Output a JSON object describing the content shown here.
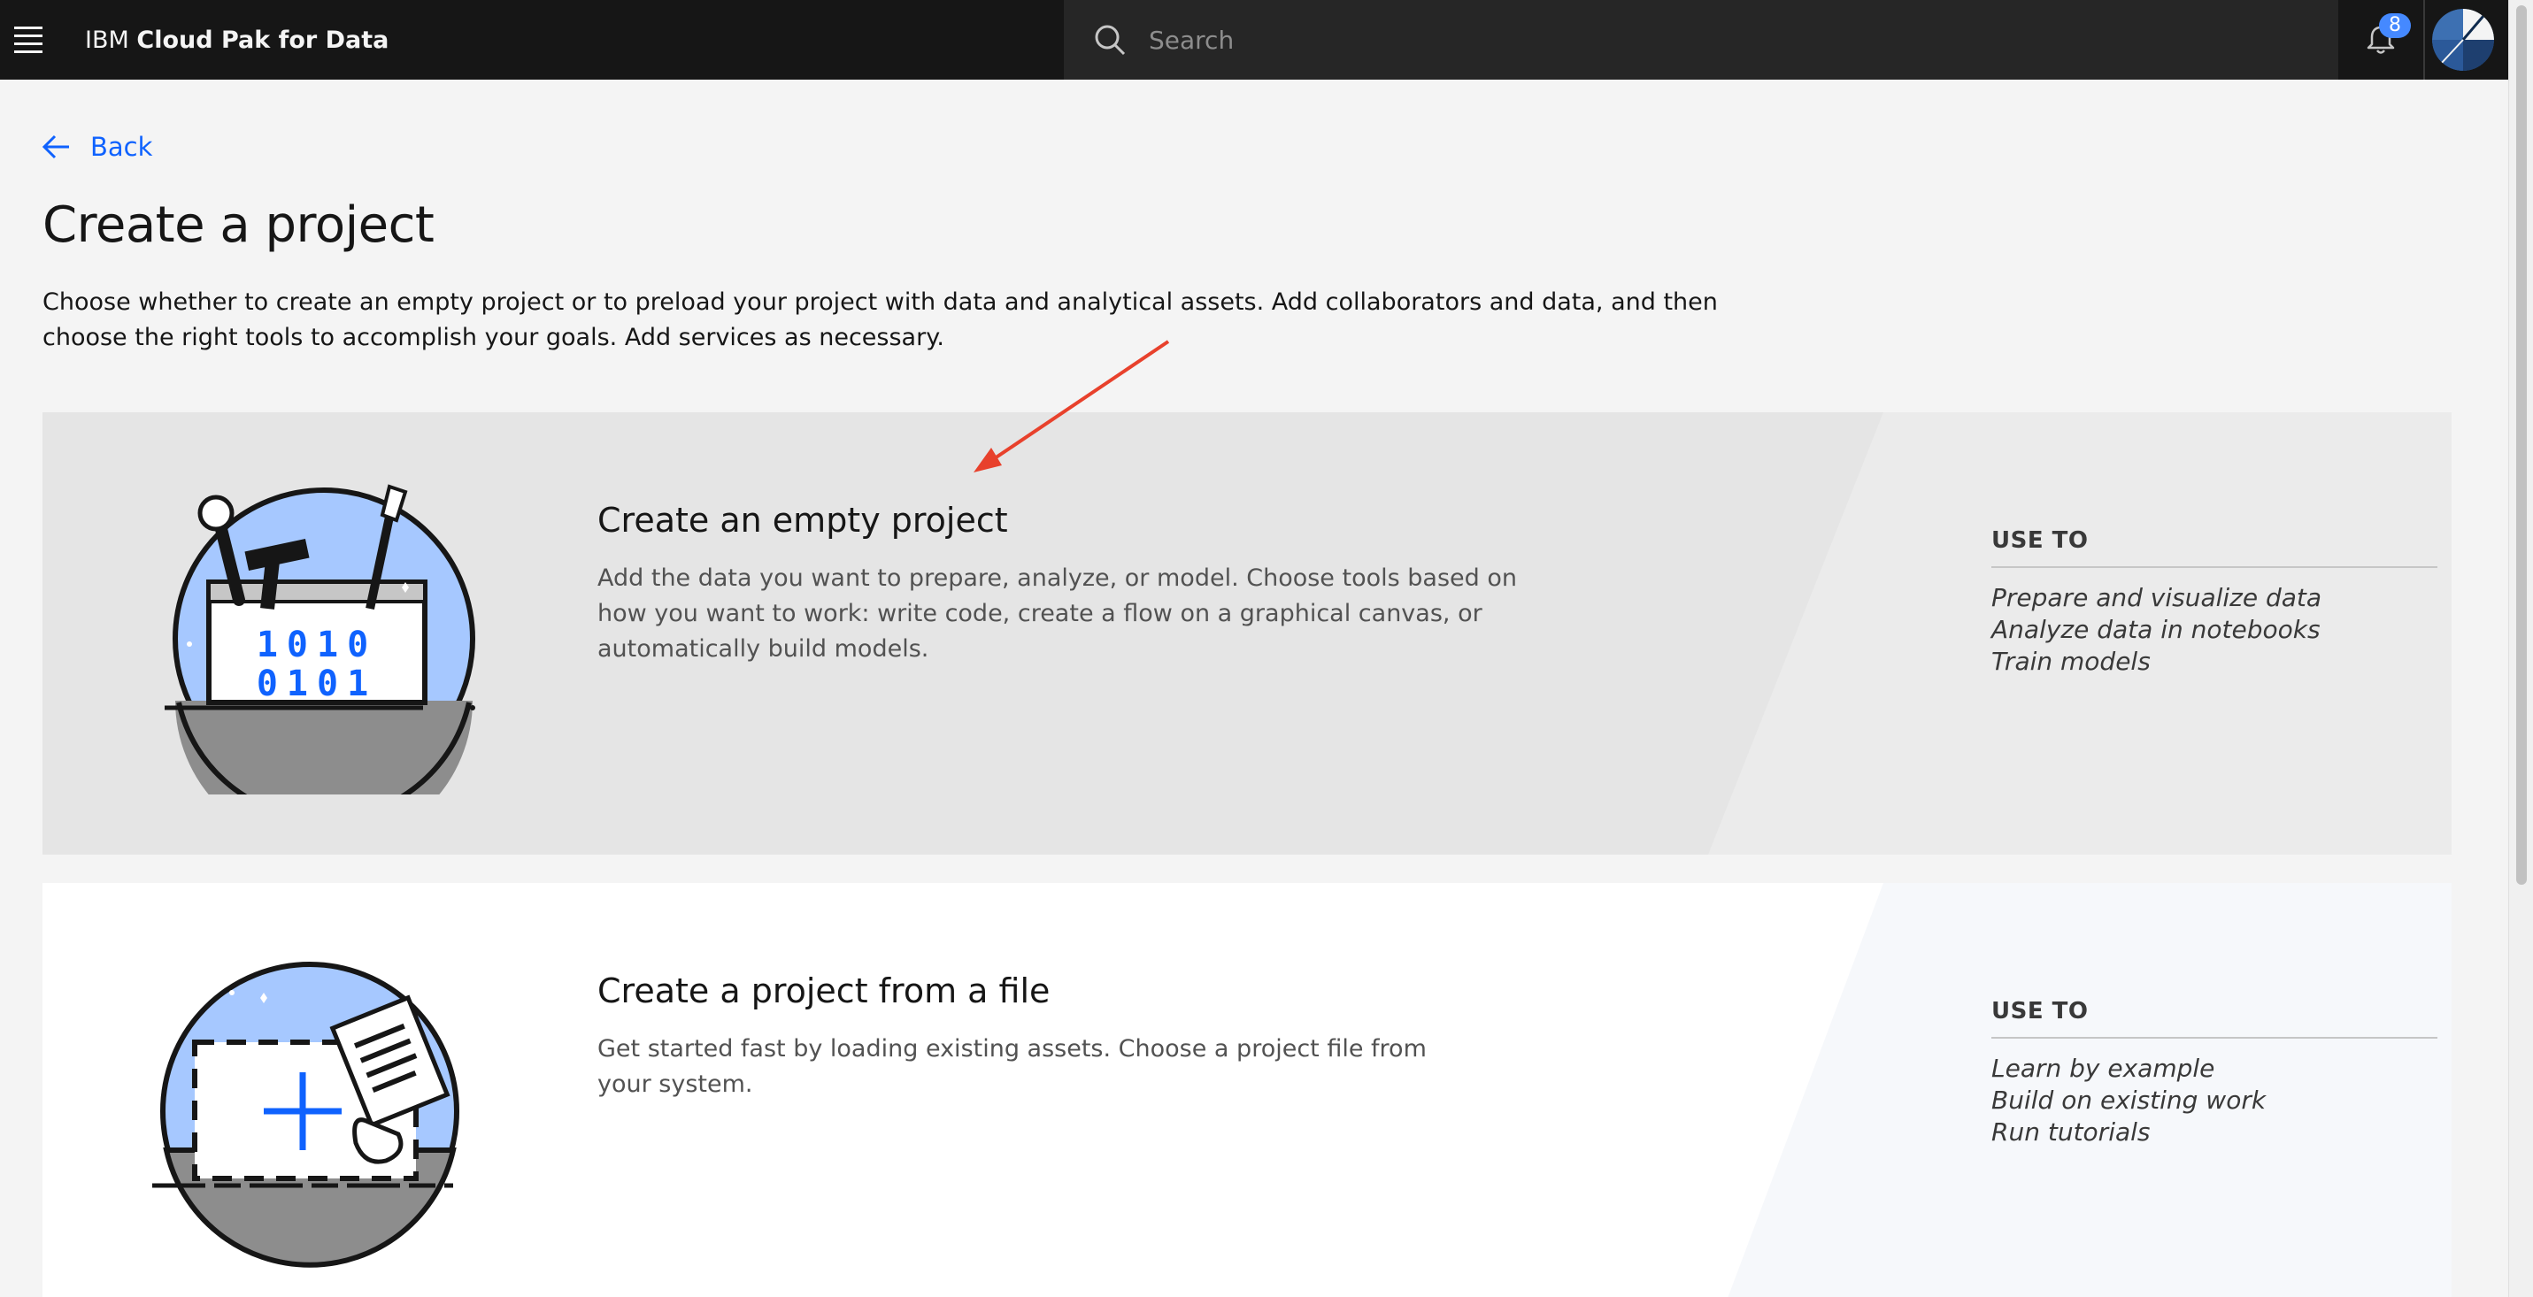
{
  "header": {
    "brand_prefix": "IBM",
    "brand_name": "Cloud Pak for Data",
    "search_placeholder": "Search",
    "notification_count": "8"
  },
  "nav": {
    "back_label": "Back"
  },
  "page": {
    "title": "Create a project",
    "description": "Choose whether to create an empty project or to preload your project with data and analytical assets. Add collaborators and data, and then choose the right tools to accomplish your goals. Add services as necessary."
  },
  "cards": [
    {
      "title": "Create an empty project",
      "description": "Add the data you want to prepare, analyze, or model. Choose tools based on how you want to work: write code, create a flow on a graphical canvas, or automatically build models.",
      "use_to_label": "USE TO",
      "uses": [
        "Prepare and visualize data",
        "Analyze data in notebooks",
        "Train models"
      ],
      "binary_line_1": "1010",
      "binary_line_2": "0101"
    },
    {
      "title": "Create a project from a file",
      "description": "Get started fast by loading existing assets. Choose a project file from your system.",
      "use_to_label": "USE TO",
      "uses": [
        "Learn by example",
        "Build on existing work",
        "Run tutorials"
      ]
    }
  ],
  "colors": {
    "accent": "#0f62fe",
    "header_bg": "#161616",
    "annotation_arrow": "#e8412c"
  }
}
